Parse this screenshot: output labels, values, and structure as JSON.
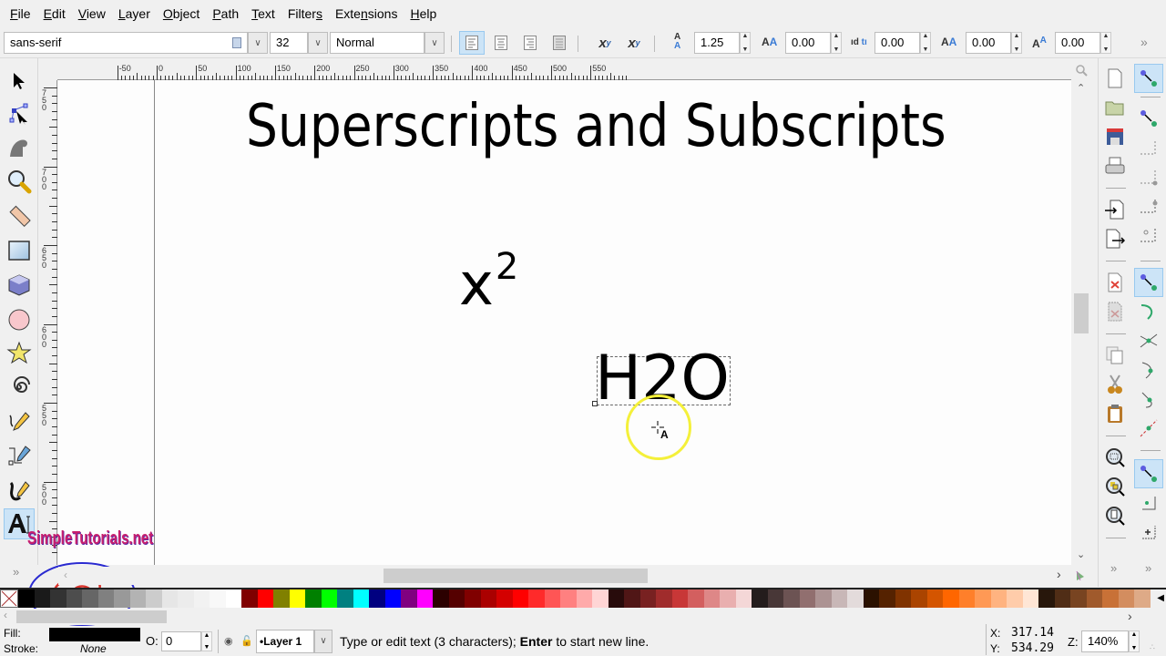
{
  "menu": [
    {
      "label": "File",
      "accel": "F"
    },
    {
      "label": "Edit",
      "accel": "E"
    },
    {
      "label": "View",
      "accel": "V"
    },
    {
      "label": "Layer",
      "accel": "L"
    },
    {
      "label": "Object",
      "accel": "O"
    },
    {
      "label": "Path",
      "accel": "P"
    },
    {
      "label": "Text",
      "accel": "T"
    },
    {
      "label": "Filters",
      "accel": "s"
    },
    {
      "label": "Extensions",
      "accel": "n"
    },
    {
      "label": "Help",
      "accel": "H"
    }
  ],
  "text_toolbar": {
    "font_family": "sans-serif",
    "font_size": "32",
    "font_style": "Normal",
    "align_buttons": [
      "align-left",
      "align-center",
      "align-right",
      "justify"
    ],
    "active_align": "align-left",
    "superscript_label": "x",
    "superscript_sup": "y",
    "subscript_label": "x",
    "subscript_sub": "y",
    "line_spacing": "1.25",
    "letter_spacing": "0.00",
    "word_spacing": "0.00",
    "kerning": "0.00",
    "vertical_shift": "0.00",
    "overflow": "»"
  },
  "ruler": {
    "h_labels": [
      "-50",
      "0",
      "50",
      "100",
      "150",
      "200",
      "250",
      "300",
      "350",
      "400",
      "450",
      "500",
      "550"
    ],
    "v_labels": [
      "750",
      "700",
      "650",
      "600",
      "550",
      "500"
    ]
  },
  "canvas": {
    "title": "Superscripts and Subscripts",
    "example1_base": "x",
    "example1_sup": "2",
    "example2_text": "H2O",
    "cursor_badge": "A"
  },
  "watermark": "SimpleTutorials.net",
  "palette": {
    "none_label": "X",
    "colors": [
      "#000000",
      "#1a1a1a",
      "#333333",
      "#4d4d4d",
      "#666666",
      "#808080",
      "#999999",
      "#b3b3b3",
      "#cccccc",
      "#e6e6e6",
      "#ececec",
      "#f2f2f2",
      "#f8f8f8",
      "#ffffff",
      "#800000",
      "#ff0000",
      "#808000",
      "#ffff00",
      "#008000",
      "#00ff00",
      "#008080",
      "#00ffff",
      "#000080",
      "#0000ff",
      "#800080",
      "#ff00ff",
      "#2b0000",
      "#550000",
      "#800000",
      "#aa0000",
      "#d40000",
      "#ff0000",
      "#ff2a2a",
      "#ff5555",
      "#ff8080",
      "#ffaaaa",
      "#ffd5d5",
      "#280b0b",
      "#501616",
      "#782121",
      "#a02c2c",
      "#c83737",
      "#d35f5f",
      "#de8787",
      "#e9afaf",
      "#f4d7d7",
      "#241c1c",
      "#483737",
      "#6c5353",
      "#916f6f",
      "#ac9393",
      "#c8b7b7",
      "#e3dbdb",
      "#2b1100",
      "#552200",
      "#803300",
      "#aa4400",
      "#d45500",
      "#ff6600",
      "#ff7f2a",
      "#ff9955",
      "#ffb380",
      "#ffccaa",
      "#ffe6d5",
      "#28170b",
      "#502d16",
      "#784421",
      "#a05a2c",
      "#c87137",
      "#d38d5f",
      "#deaa87"
    ]
  },
  "status": {
    "fill_label": "Fill:",
    "stroke_label": "Stroke:",
    "fill_color": "#000000",
    "stroke_value": "None",
    "opacity_label": "O:",
    "opacity_value": "0",
    "layer": "•Layer 1",
    "message_pre": "Type or edit text (3 characters); ",
    "message_bold": "Enter",
    "message_post": " to start new line.",
    "x_label": "X:",
    "x_value": "317.14",
    "y_label": "Y:",
    "y_value": "534.29",
    "zoom_label": "Z:",
    "zoom_value": "140%"
  }
}
